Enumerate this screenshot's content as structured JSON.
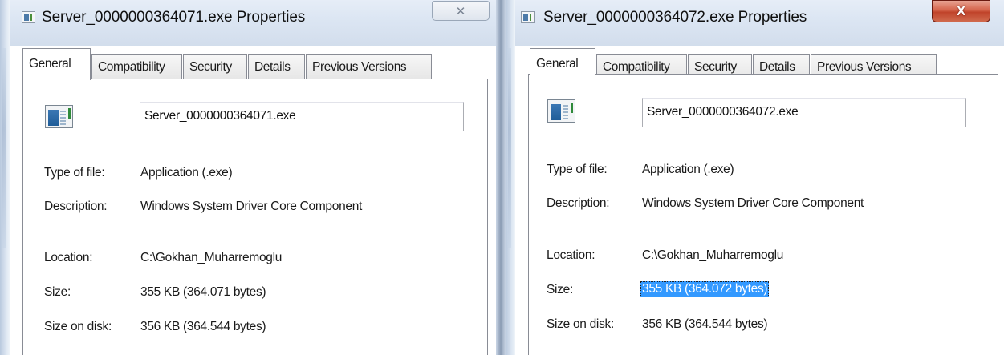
{
  "dialogs": [
    {
      "title": "Server_0000000364071.exe Properties",
      "close_glyph": "✕",
      "tabs": [
        {
          "label": "General",
          "active": true
        },
        {
          "label": "Compatibility"
        },
        {
          "label": "Security"
        },
        {
          "label": "Details"
        },
        {
          "label": "Previous Versions"
        }
      ],
      "file_icon": "application-exe-icon",
      "file_name": "Server_0000000364071.exe",
      "type_of_file": {
        "label": "Type of file:",
        "value": "Application (.exe)"
      },
      "description": {
        "label": "Description:",
        "value": "Windows System Driver Core Component"
      },
      "location": {
        "label": "Location:",
        "value": "C:\\Gokhan_Muharremoglu"
      },
      "size": {
        "label": "Size:",
        "value": "355 KB (364.071 bytes)"
      },
      "size_on_disk": {
        "label": "Size on disk:",
        "value": "356 KB (364.544 bytes)"
      }
    },
    {
      "title": "Server_0000000364072.exe Properties",
      "close_glyph": "X",
      "tabs": [
        {
          "label": "General",
          "active": true
        },
        {
          "label": "Compatibility"
        },
        {
          "label": "Security"
        },
        {
          "label": "Details"
        },
        {
          "label": "Previous Versions"
        }
      ],
      "file_icon": "application-exe-icon",
      "file_name": "Server_0000000364072.exe",
      "type_of_file": {
        "label": "Type of file:",
        "value": "Application (.exe)"
      },
      "description": {
        "label": "Description:",
        "value": "Windows System Driver Core Component"
      },
      "location": {
        "label": "Location:",
        "value": "C:\\Gokhan_Muharremoglu"
      },
      "size": {
        "label": "Size:",
        "value": "355 KB (364.072 bytes)",
        "selected": true
      },
      "size_on_disk": {
        "label": "Size on disk:",
        "value": "356 KB (364.544 bytes)"
      }
    }
  ],
  "colors": {
    "selection": "#3399ff",
    "close_button_active": "#c7452c",
    "titlebar": "#dce6f3"
  }
}
